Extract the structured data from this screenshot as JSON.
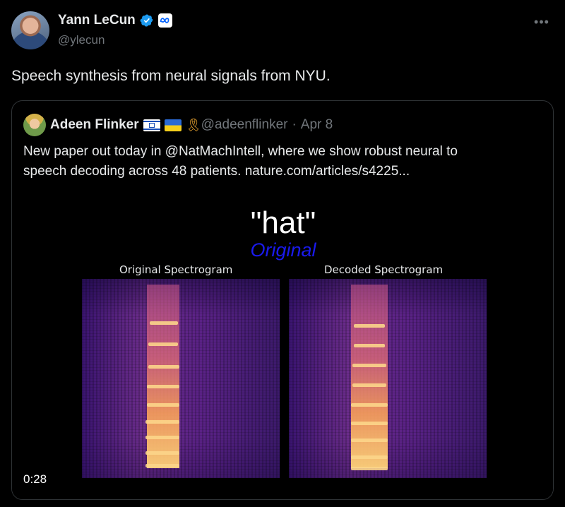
{
  "author": {
    "display_name": "Yann LeCun",
    "handle": "@ylecun"
  },
  "tweet": {
    "text": "Speech synthesis from neural signals from NYU."
  },
  "quoted": {
    "display_name": "Adeen Flinker",
    "handle": "@adeenflinker",
    "separator": "·",
    "date": "Apr 8",
    "text_line1": "New paper out today in @NatMachIntell, where we show robust neural to",
    "text_line2": "speech decoding across 48 patients. nature.com/articles/s4225..."
  },
  "media": {
    "word": "\"hat\"",
    "subtitle": "Original",
    "left_label": "Original Spectrogram",
    "right_label": "Decoded Spectrogram",
    "timestamp": "0:28"
  },
  "icons": {
    "more": "more-icon",
    "verified": "verified-badge-icon",
    "affiliation": "meta-affiliation-icon"
  },
  "colors": {
    "background": "#000000",
    "verified": "#1d9bf0",
    "subtitle": "#1a1aee",
    "muted": "#71767b"
  }
}
